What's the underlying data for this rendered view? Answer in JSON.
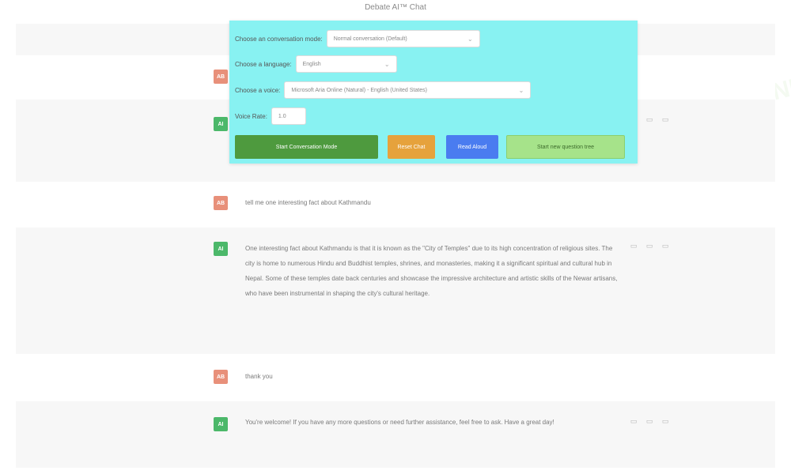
{
  "header": {
    "title": "Debate AI™ Chat"
  },
  "watermark": {
    "text": "AI CHAT ONLINE"
  },
  "panel": {
    "mode_label": "Choose an conversation mode:",
    "mode_value": "Normal conversation (Default)",
    "language_label": "Choose a language:",
    "language_value": "English",
    "voice_label": "Choose a voice:",
    "voice_value": "Microsoft Aria Online (Natural) - English (United States)",
    "speed_label": "Voice Rate:",
    "speed_value": "1.0",
    "buttons": {
      "start": "Start Conversation Mode",
      "reset": "Reset Chat",
      "read": "Read Aloud",
      "new": "Start new question tree"
    },
    "colors": {
      "background": "#88f2f2",
      "start": "#4e9a3e",
      "reset": "#e6a23c",
      "read": "#4a7cf0",
      "new": "#a6e38a"
    }
  },
  "messages": [
    {
      "role": "user",
      "avatar": "AB",
      "text": ""
    },
    {
      "role": "bot",
      "avatar": "AI",
      "text": ""
    },
    {
      "role": "user",
      "avatar": "AB",
      "text": "tell me one interesting fact about Kathmandu"
    },
    {
      "role": "bot",
      "avatar": "AI",
      "text": "One interesting fact about Kathmandu is that it is known as the \"City of Temples\" due to its high concentration of religious sites. The city is home to numerous Hindu and Buddhist temples, shrines, and monasteries, making it a significant spiritual and cultural hub in Nepal. Some of these temples date back centuries and showcase the impressive architecture and artistic skills of the Newar artisans, who have been instrumental in shaping the city's cultural heritage."
    },
    {
      "role": "user",
      "avatar": "AB",
      "text": "thank you"
    },
    {
      "role": "bot",
      "avatar": "AI",
      "text": "You're welcome! If you have any more questions or need further assistance, feel free to ask. Have a great day!"
    }
  ],
  "icons": {
    "copy": "copy-icon",
    "like": "thumbs-up-icon",
    "dislike": "thumbs-down-icon"
  }
}
